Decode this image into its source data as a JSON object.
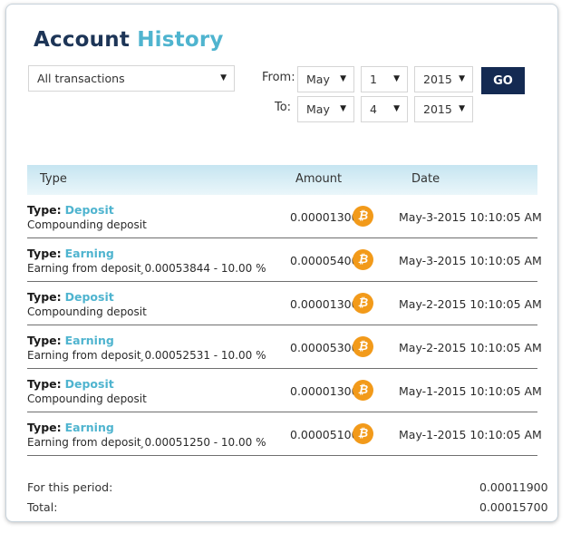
{
  "page": {
    "title_part1": "Account",
    "title_part2": "History"
  },
  "filters": {
    "transaction_type": "All transactions",
    "from_label": "From:",
    "to_label": "To:",
    "from_month": "May",
    "from_day": "1",
    "from_year": "2015",
    "to_month": "May",
    "to_day": "4",
    "to_year": "2015",
    "go_label": "GO"
  },
  "table": {
    "columns": [
      "Type",
      "Amount",
      "Date"
    ],
    "type_prefix": "Type:",
    "rows": [
      {
        "type": "Deposit",
        "description": "Compounding deposit",
        "amount": "0.00001300",
        "date": "May-3-2015 10:10:05 AM"
      },
      {
        "type": "Earning",
        "description": "Earning from deposit ̧0.00053844 - 10.00 %",
        "amount": "0.00005400",
        "date": "May-3-2015 10:10:05 AM"
      },
      {
        "type": "Deposit",
        "description": "Compounding deposit",
        "amount": "0.00001300",
        "date": "May-2-2015 10:10:05 AM"
      },
      {
        "type": "Earning",
        "description": "Earning from deposit ̧0.00052531 - 10.00 %",
        "amount": "0.00005300",
        "date": "May-2-2015 10:10:05 AM"
      },
      {
        "type": "Deposit",
        "description": "Compounding deposit",
        "amount": "0.00001300",
        "date": "May-1-2015 10:10:05 AM"
      },
      {
        "type": "Earning",
        "description": "Earning from deposit ̧0.00051250 - 10.00 %",
        "amount": "0.00005100",
        "date": "May-1-2015 10:10:05 AM"
      }
    ],
    "coin_icon": "bitcoin-icon",
    "coin_glyph": "₿",
    "coin_color": "#f29a1a"
  },
  "summary": {
    "period_label": "For this period:",
    "period_value": "0.00011900",
    "total_label": "Total:",
    "total_value": "0.00015700"
  },
  "colors": {
    "title_dark": "#1d3557",
    "accent": "#4fb4cf",
    "button": "#142a52"
  }
}
